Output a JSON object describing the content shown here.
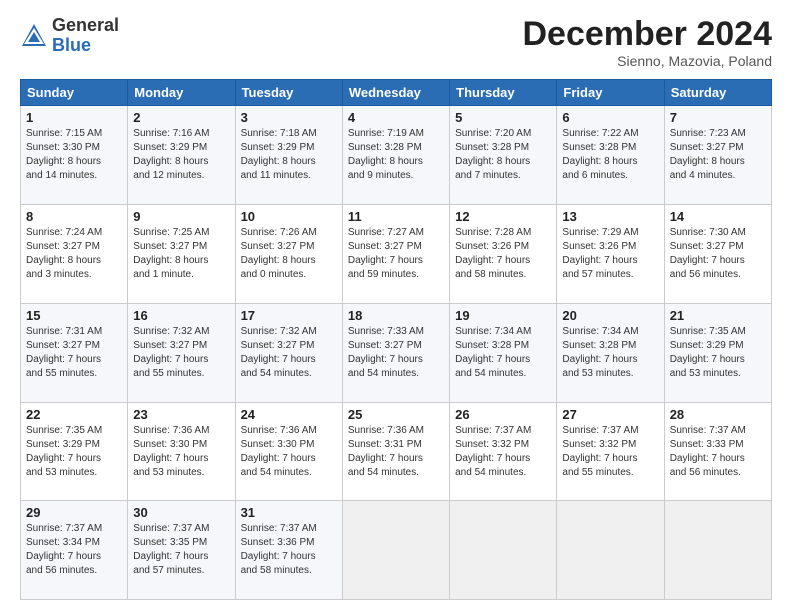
{
  "header": {
    "logo": {
      "general": "General",
      "blue": "Blue"
    },
    "title": "December 2024",
    "location": "Sienno, Mazovia, Poland"
  },
  "weekdays": [
    "Sunday",
    "Monday",
    "Tuesday",
    "Wednesday",
    "Thursday",
    "Friday",
    "Saturday"
  ],
  "weeks": [
    [
      {
        "day": 1,
        "info": "Sunrise: 7:15 AM\nSunset: 3:30 PM\nDaylight: 8 hours\nand 14 minutes."
      },
      {
        "day": 2,
        "info": "Sunrise: 7:16 AM\nSunset: 3:29 PM\nDaylight: 8 hours\nand 12 minutes."
      },
      {
        "day": 3,
        "info": "Sunrise: 7:18 AM\nSunset: 3:29 PM\nDaylight: 8 hours\nand 11 minutes."
      },
      {
        "day": 4,
        "info": "Sunrise: 7:19 AM\nSunset: 3:28 PM\nDaylight: 8 hours\nand 9 minutes."
      },
      {
        "day": 5,
        "info": "Sunrise: 7:20 AM\nSunset: 3:28 PM\nDaylight: 8 hours\nand 7 minutes."
      },
      {
        "day": 6,
        "info": "Sunrise: 7:22 AM\nSunset: 3:28 PM\nDaylight: 8 hours\nand 6 minutes."
      },
      {
        "day": 7,
        "info": "Sunrise: 7:23 AM\nSunset: 3:27 PM\nDaylight: 8 hours\nand 4 minutes."
      }
    ],
    [
      {
        "day": 8,
        "info": "Sunrise: 7:24 AM\nSunset: 3:27 PM\nDaylight: 8 hours\nand 3 minutes."
      },
      {
        "day": 9,
        "info": "Sunrise: 7:25 AM\nSunset: 3:27 PM\nDaylight: 8 hours\nand 1 minute."
      },
      {
        "day": 10,
        "info": "Sunrise: 7:26 AM\nSunset: 3:27 PM\nDaylight: 8 hours\nand 0 minutes."
      },
      {
        "day": 11,
        "info": "Sunrise: 7:27 AM\nSunset: 3:27 PM\nDaylight: 7 hours\nand 59 minutes."
      },
      {
        "day": 12,
        "info": "Sunrise: 7:28 AM\nSunset: 3:26 PM\nDaylight: 7 hours\nand 58 minutes."
      },
      {
        "day": 13,
        "info": "Sunrise: 7:29 AM\nSunset: 3:26 PM\nDaylight: 7 hours\nand 57 minutes."
      },
      {
        "day": 14,
        "info": "Sunrise: 7:30 AM\nSunset: 3:27 PM\nDaylight: 7 hours\nand 56 minutes."
      }
    ],
    [
      {
        "day": 15,
        "info": "Sunrise: 7:31 AM\nSunset: 3:27 PM\nDaylight: 7 hours\nand 55 minutes."
      },
      {
        "day": 16,
        "info": "Sunrise: 7:32 AM\nSunset: 3:27 PM\nDaylight: 7 hours\nand 55 minutes."
      },
      {
        "day": 17,
        "info": "Sunrise: 7:32 AM\nSunset: 3:27 PM\nDaylight: 7 hours\nand 54 minutes."
      },
      {
        "day": 18,
        "info": "Sunrise: 7:33 AM\nSunset: 3:27 PM\nDaylight: 7 hours\nand 54 minutes."
      },
      {
        "day": 19,
        "info": "Sunrise: 7:34 AM\nSunset: 3:28 PM\nDaylight: 7 hours\nand 54 minutes."
      },
      {
        "day": 20,
        "info": "Sunrise: 7:34 AM\nSunset: 3:28 PM\nDaylight: 7 hours\nand 53 minutes."
      },
      {
        "day": 21,
        "info": "Sunrise: 7:35 AM\nSunset: 3:29 PM\nDaylight: 7 hours\nand 53 minutes."
      }
    ],
    [
      {
        "day": 22,
        "info": "Sunrise: 7:35 AM\nSunset: 3:29 PM\nDaylight: 7 hours\nand 53 minutes."
      },
      {
        "day": 23,
        "info": "Sunrise: 7:36 AM\nSunset: 3:30 PM\nDaylight: 7 hours\nand 53 minutes."
      },
      {
        "day": 24,
        "info": "Sunrise: 7:36 AM\nSunset: 3:30 PM\nDaylight: 7 hours\nand 54 minutes."
      },
      {
        "day": 25,
        "info": "Sunrise: 7:36 AM\nSunset: 3:31 PM\nDaylight: 7 hours\nand 54 minutes."
      },
      {
        "day": 26,
        "info": "Sunrise: 7:37 AM\nSunset: 3:32 PM\nDaylight: 7 hours\nand 54 minutes."
      },
      {
        "day": 27,
        "info": "Sunrise: 7:37 AM\nSunset: 3:32 PM\nDaylight: 7 hours\nand 55 minutes."
      },
      {
        "day": 28,
        "info": "Sunrise: 7:37 AM\nSunset: 3:33 PM\nDaylight: 7 hours\nand 56 minutes."
      }
    ],
    [
      {
        "day": 29,
        "info": "Sunrise: 7:37 AM\nSunset: 3:34 PM\nDaylight: 7 hours\nand 56 minutes."
      },
      {
        "day": 30,
        "info": "Sunrise: 7:37 AM\nSunset: 3:35 PM\nDaylight: 7 hours\nand 57 minutes."
      },
      {
        "day": 31,
        "info": "Sunrise: 7:37 AM\nSunset: 3:36 PM\nDaylight: 7 hours\nand 58 minutes."
      },
      null,
      null,
      null,
      null
    ]
  ]
}
